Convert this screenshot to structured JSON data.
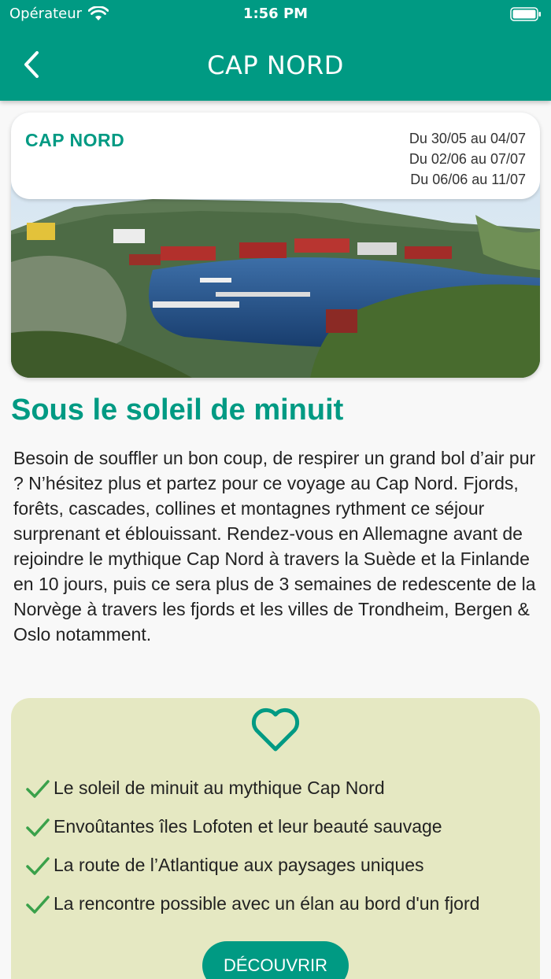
{
  "status_bar": {
    "carrier": "Opérateur",
    "time": "1:56 PM"
  },
  "nav": {
    "title": "CAP NORD",
    "back_icon": "chevron-left-icon"
  },
  "card": {
    "title": "CAP NORD",
    "dates": [
      "Du 30/05 au 04/07",
      "Du 02/06 au 07/07",
      "Du 06/06 au 11/07"
    ]
  },
  "section": {
    "heading": "Sous le soleil de minuit",
    "description": "Besoin de souffler un bon coup, de respirer un grand bol d’air pur ? N’hésitez plus et partez pour ce voyage au Cap Nord. Fjords, forêts, cascades, collines et montagnes rythment ce séjour surprenant et éblouissant. Rendez-vous en Allemagne avant de rejoindre le mythique Cap Nord à travers la Suède et la Finlande en 10 jours, puis ce sera plus de 3 semaines de redescente de la Norvège à travers les fjords et les villes de Trondheim, Bergen & Oslo notamment."
  },
  "highlights": {
    "icon": "heart-icon",
    "items": [
      "Le soleil de minuit au mythique Cap Nord",
      "Envoûtantes îles Lofoten et leur beauté sauvage",
      "La route de l’Atlantique aux paysages uniques",
      "La rencontre possible avec un élan au bord d'un fjord"
    ],
    "button": "DÉCOUVRIR"
  },
  "colors": {
    "primary": "#009a83",
    "highlight_bg": "#e5e8c2",
    "check": "#3aa14a"
  }
}
